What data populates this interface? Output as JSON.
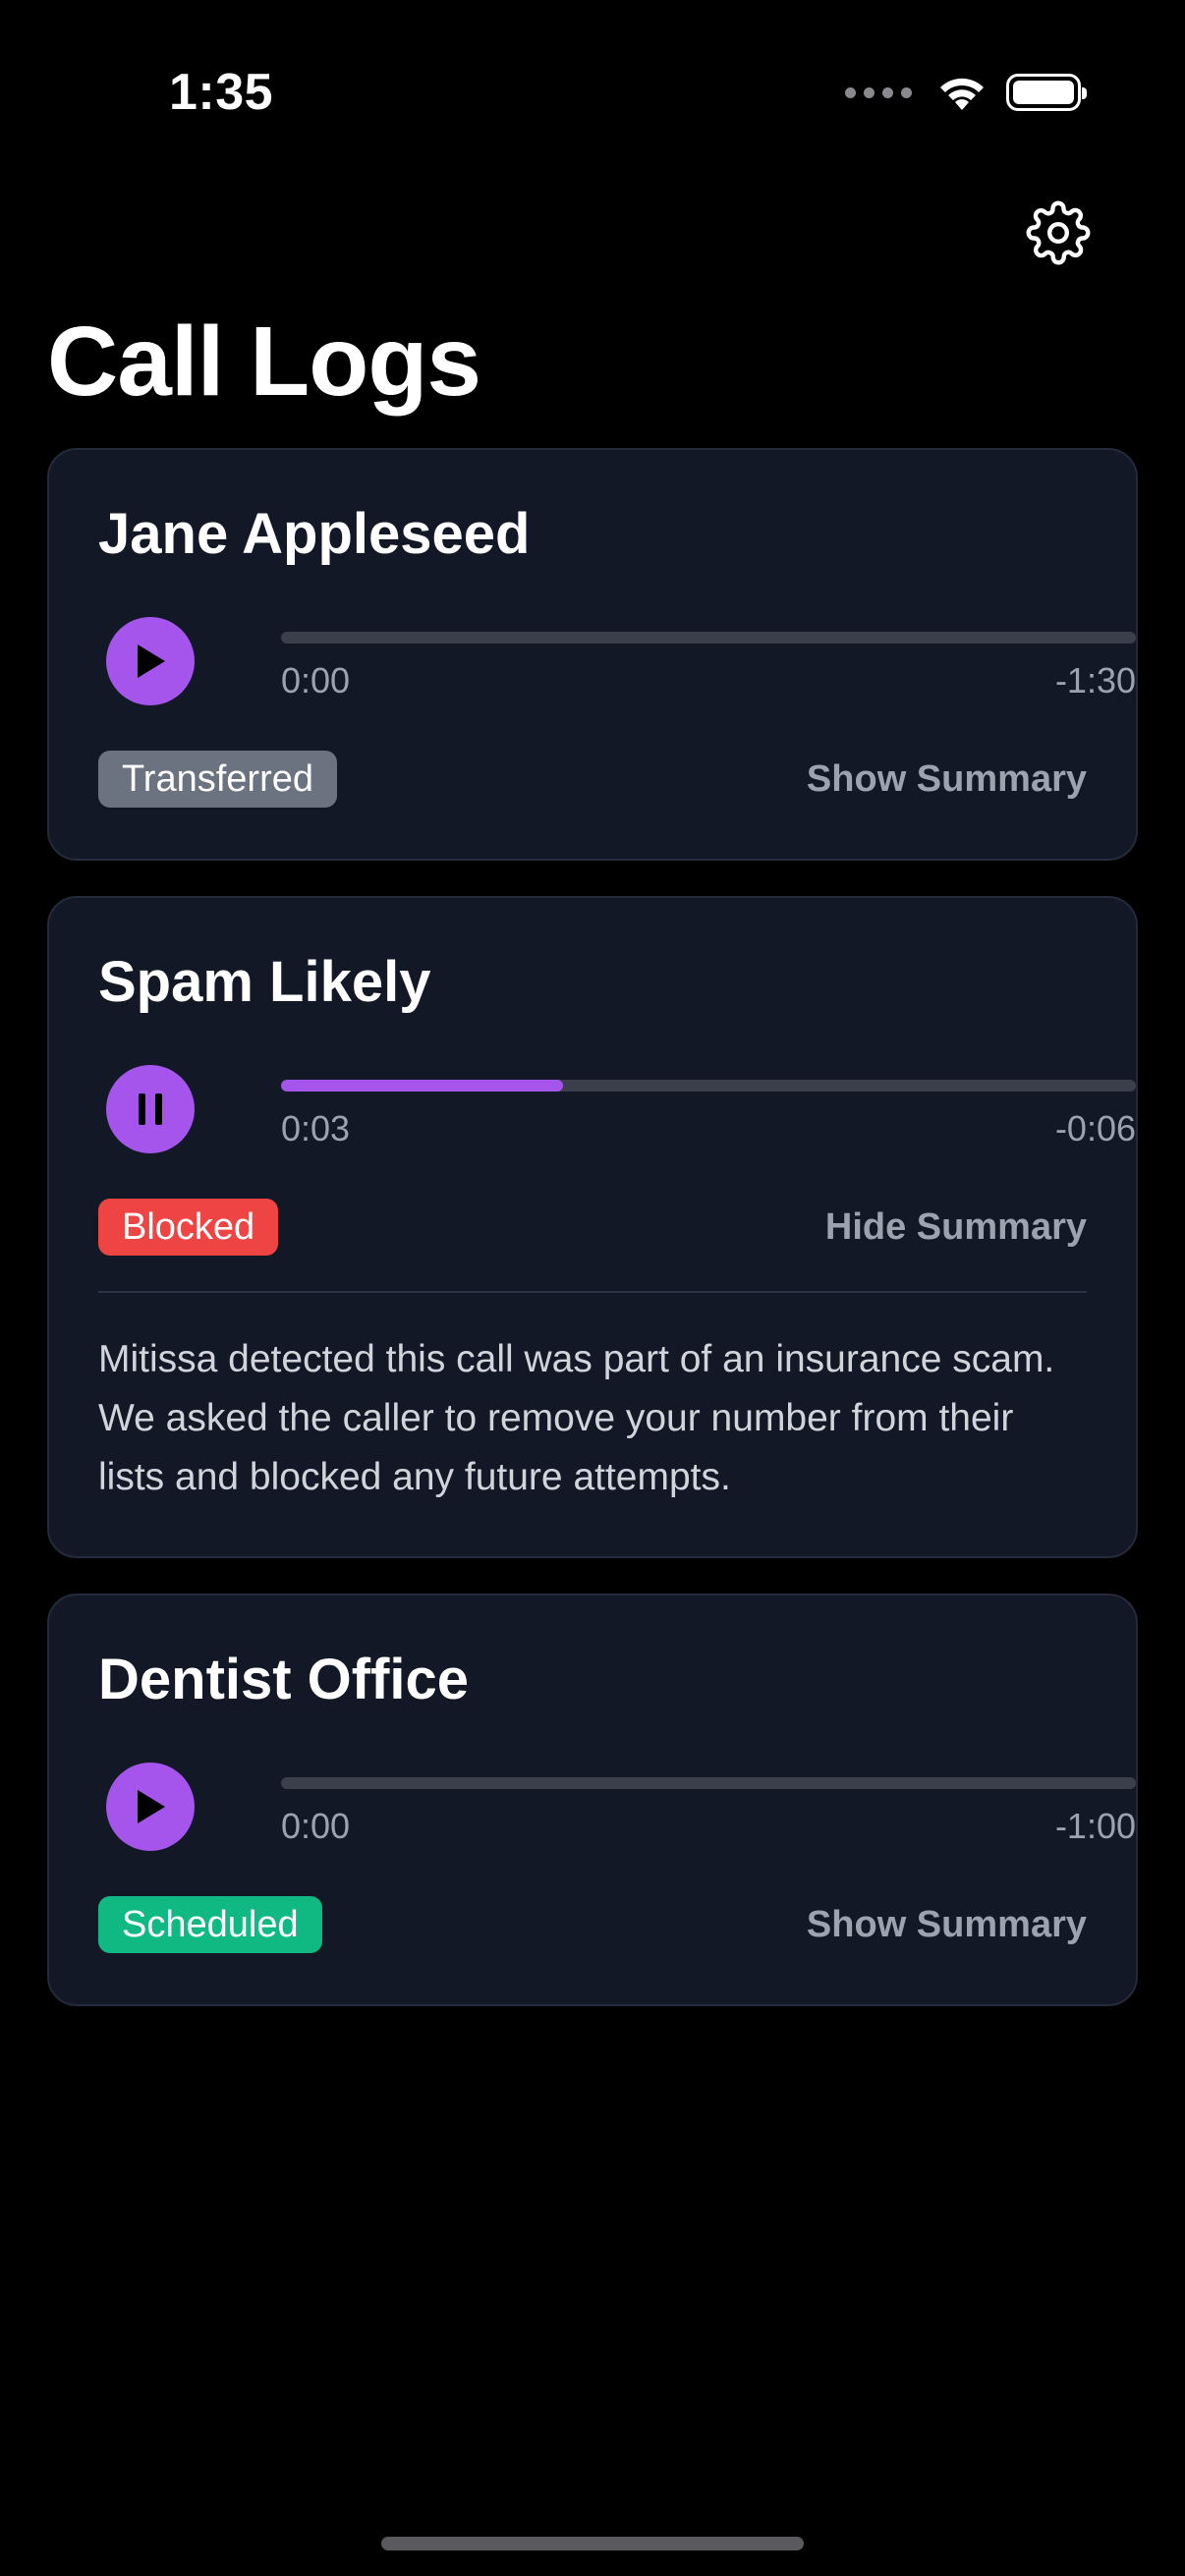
{
  "status_bar": {
    "time": "1:35"
  },
  "header": {
    "title": "Call Logs"
  },
  "icons": {
    "settings": "gear-icon",
    "play": "play-icon",
    "pause": "pause-icon",
    "wifi": "wifi-icon",
    "battery": "battery-icon"
  },
  "colors": {
    "accent": "#a555ec",
    "card_bg": "#131826",
    "transferred": "#6b7280",
    "blocked": "#ef4444",
    "scheduled": "#10b981"
  },
  "calls": [
    {
      "name": "Jane Appleseed",
      "state": "paused",
      "elapsed": "0:00",
      "remaining": "-1:30",
      "progress_fraction": 0,
      "status": "Transferred",
      "status_color": "#6b7280",
      "summary_toggle": "Show Summary",
      "summary_expanded": false
    },
    {
      "name": "Spam Likely",
      "state": "playing",
      "elapsed": "0:03",
      "remaining": "-0:06",
      "progress_fraction": 0.33,
      "status": "Blocked",
      "status_color": "#ef4444",
      "summary_toggle": "Hide Summary",
      "summary_expanded": true,
      "summary": "Mitissa detected this call was part of an insurance scam. We asked the caller to remove your number from their lists and blocked any future attempts."
    },
    {
      "name": "Dentist Office",
      "state": "paused",
      "elapsed": "0:00",
      "remaining": "-1:00",
      "progress_fraction": 0,
      "status": "Scheduled",
      "status_color": "#10b981",
      "summary_toggle": "Show Summary",
      "summary_expanded": false
    }
  ]
}
